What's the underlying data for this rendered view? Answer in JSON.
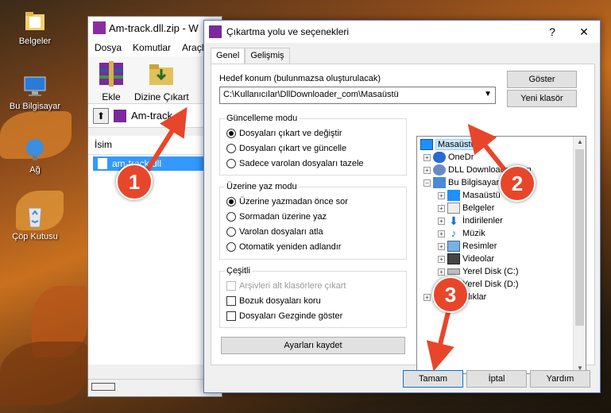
{
  "desktop": {
    "icons": [
      {
        "label": "Belgeler",
        "icon": "documents-folder-icon"
      },
      {
        "label": "Bu Bilgisayar",
        "icon": "computer-icon"
      },
      {
        "label": "Ağ",
        "icon": "network-icon"
      },
      {
        "label": "Çöp Kutusu",
        "icon": "recycle-bin-icon"
      }
    ]
  },
  "winrar": {
    "title": "Am-track.dll.zip - W",
    "menu": [
      "Dosya",
      "Komutlar",
      "Araçla"
    ],
    "toolbar": {
      "add": "Ekle",
      "extract": "Dizine Çıkart"
    },
    "address": "Am-track.d",
    "list_header": "İsim",
    "file": "am-track.dll"
  },
  "dialog": {
    "title": "Çıkartma yolu ve seçenekleri",
    "help": "?",
    "close": "✕",
    "tabs": [
      "Genel",
      "Gelişmiş"
    ],
    "dest_label": "Hedef konum (bulunmazsa oluşturulacak)",
    "dest_value": "C:\\Kullanıcılar\\DllDownloader_com\\Masaüstü",
    "show_btn": "Göster",
    "new_folder_btn": "Yeni klasör",
    "update_group": {
      "title": "Güncelleme modu",
      "options": [
        "Dosyaları çıkart ve değiştir",
        "Dosyaları çıkart ve güncelle",
        "Sadece varolan dosyaları tazele"
      ],
      "selected": 0
    },
    "overwrite_group": {
      "title": "Üzerine yaz modu",
      "options": [
        "Üzerine yazmadan önce sor",
        "Sormadan üzerine yaz",
        "Varolan dosyaları atla",
        "Otomatik yeniden adlandır"
      ],
      "selected": 0
    },
    "misc_group": {
      "title": "Çeşitli",
      "options": [
        "Arşivleri alt klasörlere çıkart",
        "Bozuk dosyaları koru",
        "Dosyaları Gezginde göster"
      ]
    },
    "save_btn": "Ayarları kaydet",
    "tree": [
      {
        "label": "Masaüstü",
        "icon": "desktop-icon",
        "selected": true
      },
      {
        "label": "OneDr",
        "icon": "onedrive-icon"
      },
      {
        "label": "DLL Downloader.com",
        "icon": "user-icon"
      },
      {
        "label": "Bu Bilgisayar",
        "icon": "computer-icon"
      },
      {
        "label": "Masaüstü",
        "icon": "desktop-icon"
      },
      {
        "label": "Belgeler",
        "icon": "documents-icon"
      },
      {
        "label": "İndirilenler",
        "icon": "downloads-icon"
      },
      {
        "label": "Müzik",
        "icon": "music-icon"
      },
      {
        "label": "Resimler",
        "icon": "pictures-icon"
      },
      {
        "label": "Videolar",
        "icon": "videos-icon"
      },
      {
        "label": "Yerel Disk (C:)",
        "icon": "disk-icon"
      },
      {
        "label": "Yerel Disk (D:)",
        "icon": "disk-icon"
      },
      {
        "label": "Kitaplıklar",
        "icon": "libraries-icon"
      }
    ],
    "ok_btn": "Tamam",
    "cancel_btn": "İptal",
    "help_btn": "Yardım"
  },
  "callouts": [
    "1",
    "2",
    "3"
  ],
  "colors": {
    "callout": "#e8462a",
    "selection": "#3399ff",
    "accent": "#0078d7"
  }
}
